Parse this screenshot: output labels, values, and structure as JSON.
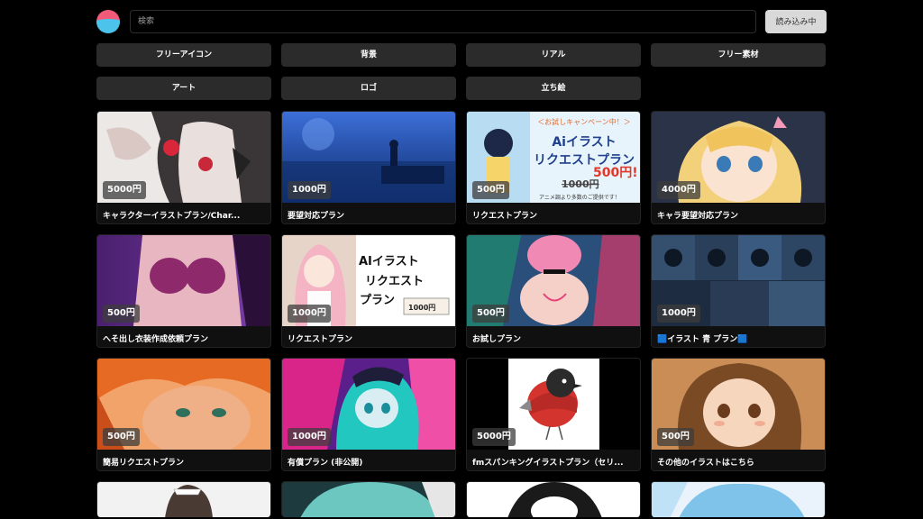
{
  "header": {
    "search_placeholder": "検索",
    "loading_label": "読み込み中"
  },
  "categories": [
    "フリーアイコン",
    "背景",
    "リアル",
    "フリー素材",
    "アート",
    "ロゴ",
    "立ち絵"
  ],
  "cards": [
    {
      "price": "5000円",
      "title": "キャラクターイラストプラン/Char..."
    },
    {
      "price": "1000円",
      "title": "要望対応プラン"
    },
    {
      "price": "500円",
      "title": "リクエストプラン"
    },
    {
      "price": "4000円",
      "title": "キャラ要望対応プラン"
    },
    {
      "price": "500円",
      "title": "へそ出し衣装作成依頼プラン"
    },
    {
      "price": "1000円",
      "title": "リクエストプラン"
    },
    {
      "price": "500円",
      "title": "お試しプラン"
    },
    {
      "price": "1000円",
      "title": "🟦イラスト 青 プラン🟦"
    },
    {
      "price": "500円",
      "title": "簡易リクエストプラン"
    },
    {
      "price": "1000円",
      "title": "有償プラン (非公開)"
    },
    {
      "price": "5000円",
      "title": "fmスパンキングイラストプラン（セリ..."
    },
    {
      "price": "500円",
      "title": "その他のイラストはこちら"
    }
  ],
  "thumb_texts": {
    "card3_banner_top": "＜お試しキャンペーン中！＞",
    "card3_line1": "Aiイラスト",
    "card3_line2": "リクエストプラン",
    "card3_old_price": "1000円",
    "card3_new_price": "500円!",
    "card3_footer": "アニメ調より多数のご提供です！",
    "card6_line1": "AIイラスト",
    "card6_line2": "リクエスト",
    "card6_line3": "プラン",
    "card6_ticket": "1000円"
  },
  "colors": {
    "background": "#000000",
    "button_bg": "#2b2b2b",
    "loading_bg": "#d9d9d9",
    "logo_pink": "#f25a7a",
    "logo_blue": "#4cc3ea"
  }
}
